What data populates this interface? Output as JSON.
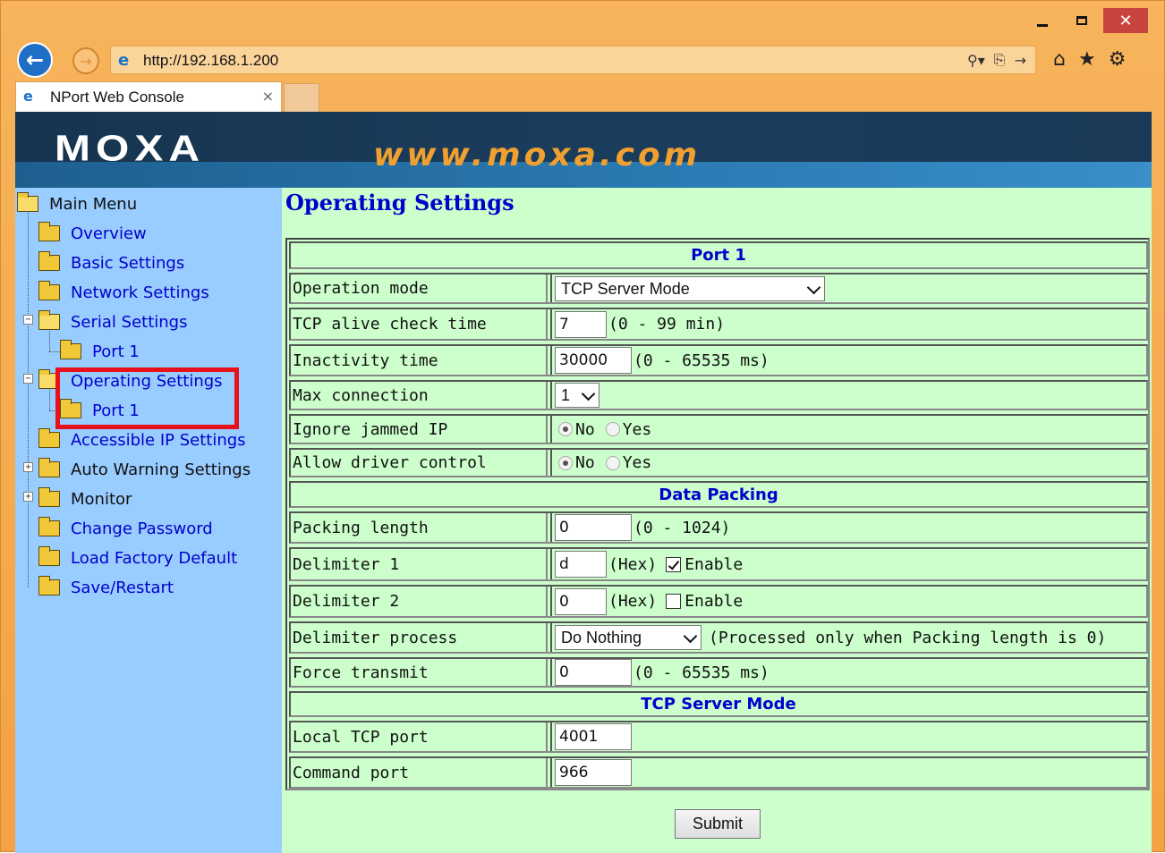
{
  "browser": {
    "url": "http://192.168.1.200",
    "tab_title": "NPort Web Console",
    "tab_close": "×",
    "window_buttons": {
      "close": "✕"
    }
  },
  "banner": {
    "logo": "MOXA",
    "site": "www.moxa.com"
  },
  "menu": {
    "root": "Main Menu",
    "items": [
      "Overview",
      "Basic Settings",
      "Network Settings",
      "Serial Settings",
      "Port 1",
      "Operating Settings",
      "Port 1",
      "Accessible IP Settings",
      "Auto Warning Settings",
      "Monitor",
      "Change Password",
      "Load Factory Default",
      "Save/Restart"
    ]
  },
  "page": {
    "title": "Operating Settings",
    "sections": {
      "port": "Port 1",
      "packing": "Data Packing",
      "mode": "TCP Server Mode"
    },
    "fields": {
      "operation_mode": {
        "label": "Operation mode",
        "value": "TCP Server Mode"
      },
      "tcp_alive": {
        "label": "TCP alive check time",
        "value": "7",
        "hint": "(0 - 99 min)"
      },
      "inactivity": {
        "label": "Inactivity time",
        "value": "30000",
        "hint": "(0 - 65535 ms)"
      },
      "max_connection": {
        "label": "Max connection",
        "value": "1"
      },
      "ignore_jammed": {
        "label": "Ignore jammed IP",
        "opt_no": "No",
        "opt_yes": "Yes",
        "selected": "No"
      },
      "allow_driver": {
        "label": "Allow driver control",
        "opt_no": "No",
        "opt_yes": "Yes",
        "selected": "No"
      },
      "packing_length": {
        "label": "Packing length",
        "value": "0",
        "hint": "(0 - 1024)"
      },
      "delimiter1": {
        "label": "Delimiter 1",
        "value": "d",
        "hint": "(Hex)",
        "enable": "Enable",
        "checked": true
      },
      "delimiter2": {
        "label": "Delimiter 2",
        "value": "0",
        "hint": "(Hex)",
        "enable": "Enable",
        "checked": false
      },
      "delimiter_process": {
        "label": "Delimiter process",
        "value": "Do Nothing",
        "hint": "(Processed only when Packing length is 0)"
      },
      "force_transmit": {
        "label": "Force transmit",
        "value": "0",
        "hint": "(0 - 65535 ms)"
      },
      "local_tcp_port": {
        "label": "Local TCP port",
        "value": "4001"
      },
      "command_port": {
        "label": "Command port",
        "value": "966"
      }
    },
    "submit": "Submit"
  }
}
